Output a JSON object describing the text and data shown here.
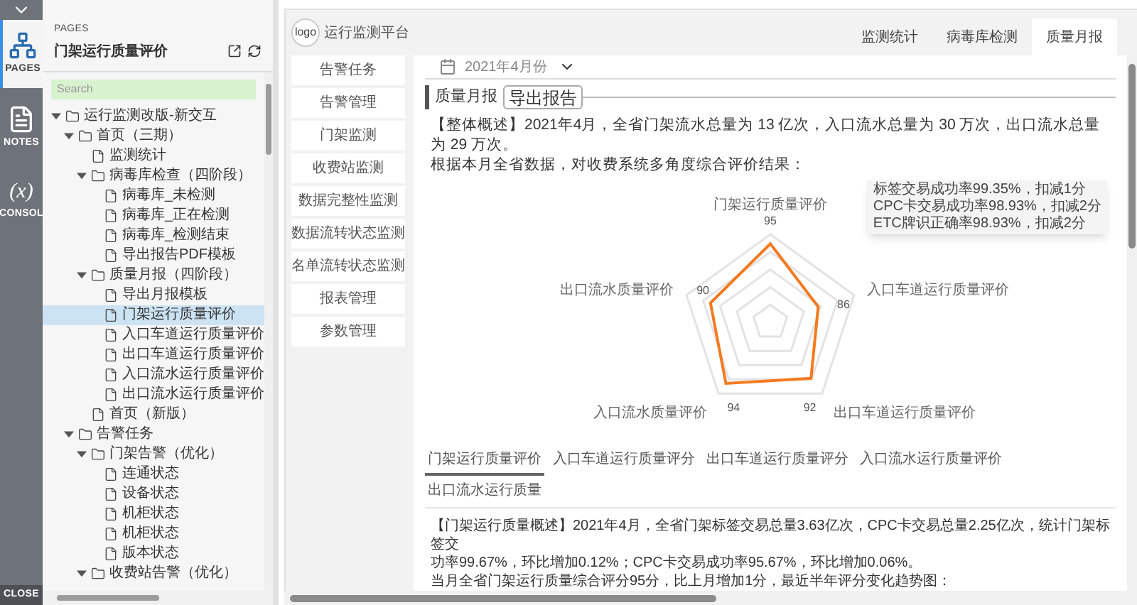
{
  "rail": {
    "items": [
      {
        "kind": "pages",
        "label": "PAGES",
        "selected": true
      },
      {
        "kind": "notes",
        "label": "NOTES",
        "selected": false
      },
      {
        "kind": "console",
        "glyph": "(x)",
        "label": "CONSOL",
        "selected": false
      }
    ],
    "close": "CLOSE"
  },
  "pages_panel": {
    "heading": "PAGES",
    "title": "门架运行质量评价",
    "search": {
      "placeholder": "Search"
    },
    "tree": [
      {
        "kind": "folder",
        "label": "运行监测改版-新交互",
        "expanded": true,
        "children": [
          {
            "kind": "folder",
            "label": "首页（三期）",
            "expanded": true,
            "children": [
              {
                "kind": "page",
                "label": "监测统计",
                "selected": false
              },
              {
                "kind": "folder",
                "label": "病毒库检查（四阶段）",
                "expanded": true,
                "children": [
                  {
                    "kind": "page",
                    "label": "病毒库_未检测",
                    "selected": false
                  },
                  {
                    "kind": "page",
                    "label": "病毒库_正在检测",
                    "selected": false
                  },
                  {
                    "kind": "page",
                    "label": "病毒库_检测结束",
                    "selected": false
                  },
                  {
                    "kind": "page",
                    "label": "导出报告PDF模板",
                    "selected": false
                  }
                ]
              },
              {
                "kind": "folder",
                "label": "质量月报（四阶段）",
                "expanded": true,
                "children": [
                  {
                    "kind": "page",
                    "label": "导出月报模板",
                    "selected": false
                  },
                  {
                    "kind": "page",
                    "label": "门架运行质量评价",
                    "selected": true
                  },
                  {
                    "kind": "page",
                    "label": "入口车道运行质量评价",
                    "selected": false
                  },
                  {
                    "kind": "page",
                    "label": "出口车道运行质量评价",
                    "selected": false
                  },
                  {
                    "kind": "page",
                    "label": "入口流水运行质量评价",
                    "selected": false
                  },
                  {
                    "kind": "page",
                    "label": "出口流水运行质量评价",
                    "selected": false
                  }
                ]
              },
              {
                "kind": "page",
                "label": "首页（新版）",
                "selected": false
              }
            ]
          },
          {
            "kind": "folder",
            "label": "告警任务",
            "expanded": true,
            "children": [
              {
                "kind": "folder",
                "label": "门架告警（优化）",
                "expanded": true,
                "children": [
                  {
                    "kind": "page",
                    "label": "连通状态",
                    "selected": false
                  },
                  {
                    "kind": "page",
                    "label": "设备状态",
                    "selected": false
                  },
                  {
                    "kind": "page",
                    "label": "机柜状态",
                    "selected": false
                  },
                  {
                    "kind": "page",
                    "label": "机柜状态",
                    "selected": false
                  },
                  {
                    "kind": "page",
                    "label": "版本状态",
                    "selected": false
                  }
                ]
              },
              {
                "kind": "folder",
                "label": "收费站告警（优化）",
                "expanded": true
              }
            ]
          }
        ]
      }
    ]
  },
  "app": {
    "logo": "logo",
    "title": "运行监测平台",
    "tabs": [
      {
        "label": "监测统计",
        "selected": false
      },
      {
        "label": "病毒库检测",
        "selected": false
      },
      {
        "label": "质量月报",
        "selected": true
      }
    ],
    "menu": [
      "告警任务",
      "告警管理",
      "门架监测",
      "收费站监测",
      "数据完整性监测",
      "数据流转状态监测",
      "名单流转状态监测",
      "报表管理",
      "参数管理"
    ],
    "month": "2021年4月份",
    "section_title": "质量月报",
    "export_button": "导出报告",
    "overview": [
      "【整体概述】2021年4月，全省门架流水总量为 13 亿次，入口流水总量为 30 万次，出口流水总量为 29 万次。",
      "根据本月全省数据，对收费系统多角度综合评价结果："
    ],
    "radar": {
      "indicators": [
        {
          "name": "门架运行质量评价",
          "value": "95"
        },
        {
          "name": "出口流水质量评价",
          "value": "90"
        },
        {
          "name": "入口车道运行质量评价",
          "value": "86"
        },
        {
          "name": "入口流水质量评价",
          "value": "94"
        },
        {
          "name": "出口车道运行质量评价",
          "value": "92"
        }
      ],
      "tooltip": [
        "标签交易成功率99.35%，扣减1分",
        "CPC卡交易成功率98.93%，扣减2分",
        "ETC牌识正确率98.93%，扣减2分"
      ]
    },
    "detail_tabs": [
      {
        "label": "门架运行质量评价",
        "selected": true
      },
      {
        "label": "入口车道运行质量评分",
        "selected": false
      },
      {
        "label": "出口车道运行质量评分",
        "selected": false
      },
      {
        "label": "入口流水运行质量评价",
        "selected": false
      },
      {
        "label": "出口流水运行质量",
        "selected": false
      }
    ],
    "detail": [
      "【门架运行质量概述】2021年4月，全省门架标签交易总量3.63亿次，CPC卡交易总量2.25亿次，统计门架标签交",
      "功率99.67%，环比增加0.12%；CPC卡交易成功率95.67%，环比增加0.06%。",
      "当月全省门架运行质量综合评分95分，比上月增加1分，最近半年评分变化趋势图："
    ]
  }
}
